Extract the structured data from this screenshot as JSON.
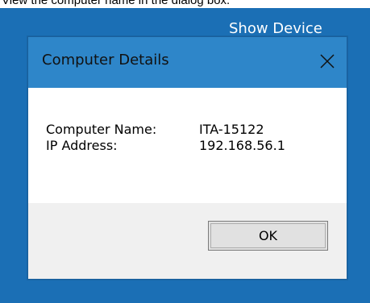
{
  "instruction": "View the computer name in the dialog box.",
  "desktop": {
    "label": "Show Device",
    "background_color": "#1b6fb5"
  },
  "dialog": {
    "title": "Computer Details",
    "close_icon": "close-icon",
    "fields": [
      {
        "label": "Computer Name:",
        "value": "ITA-15122"
      },
      {
        "label": "IP Address:",
        "value": "192.168.56.1"
      }
    ],
    "ok_label": "OK",
    "titlebar_color": "#2e86c9"
  }
}
